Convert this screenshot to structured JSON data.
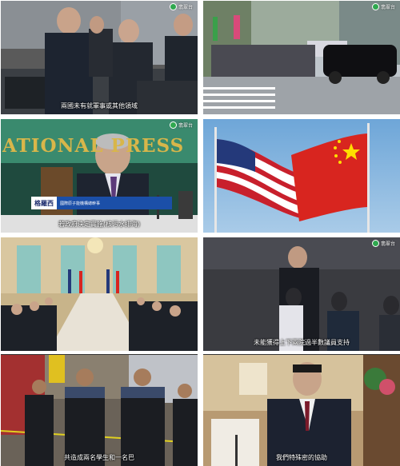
{
  "watermark": "翡翠台",
  "tiles": [
    {
      "id": "t1",
      "subtitle": "兩國未有就軍事或其他領域"
    },
    {
      "id": "t2",
      "subtitle": ""
    },
    {
      "id": "t3",
      "subtitle": "若政府決定實施(核污水排海)",
      "banner": "ATIONAL PRESS",
      "lower_third": {
        "name": "格羅西",
        "title": "國際原子能機構總幹事"
      }
    },
    {
      "id": "t4",
      "subtitle": ""
    },
    {
      "id": "t5",
      "subtitle": ""
    },
    {
      "id": "t6",
      "subtitle": "未能獲得上下兩院過半數議員支持"
    },
    {
      "id": "t7",
      "subtitle": "共造成兩名學生和一名巴"
    },
    {
      "id": "t8",
      "subtitle": "我們特殊密的協助"
    }
  ],
  "colors": {
    "watermark_green": "#2fa84f",
    "banner_gold": "#d8b64a",
    "lower_third_blue": "#1b4fa8"
  }
}
